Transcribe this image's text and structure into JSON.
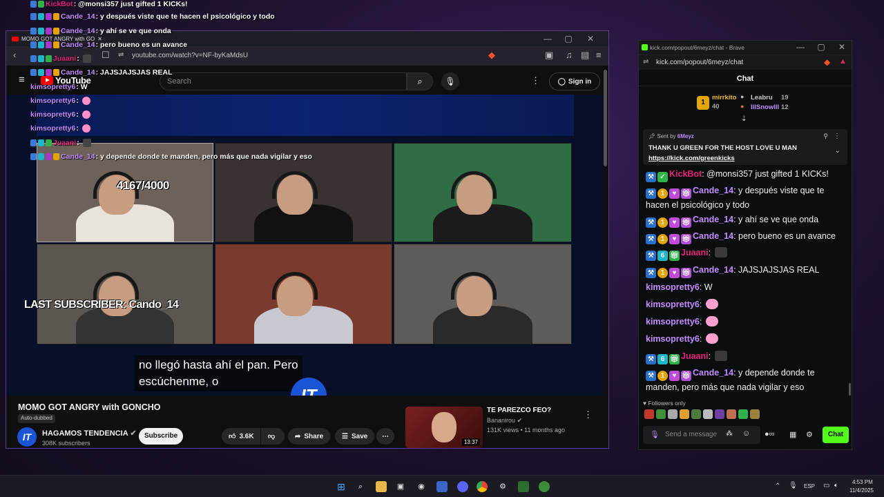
{
  "youtube": {
    "tab_title": "MOMO GOT ANGRY with GO",
    "url": "youtube.com/watch?v=NF-byKaMdsU",
    "search_placeholder": "Search",
    "logo": "YouTube",
    "signin_label": "Sign in",
    "overlay_sub_count": "4167/4000",
    "overlay_last_sub": "LAST SUBSCRIBER: Cando_14",
    "caption_line1": "no llegó hasta ahí el pan. Pero",
    "caption_line2": "escúchenme, o",
    "video_title": "MOMO GOT ANGRY with GONCHO",
    "auto_dubbed": "Auto-dubbed",
    "channel_name": "HAGAMOS TENDENCIA",
    "channel_subs": "308K subscribers",
    "subscribe_label": "Subscribe",
    "likes": "3.6K",
    "share_label": "Share",
    "save_label": "Save",
    "rec_title": "TE PAREZCO FEO?",
    "rec_channel": "Bananirou",
    "rec_meta": "131K views • 11 months ago",
    "rec_duration": "13:37"
  },
  "overlay_chat": [
    {
      "user": "KickBot",
      "text": " : @monsi357 just gifted 1 KICKs!",
      "color": "pink"
    },
    {
      "user": "Cande_14",
      "text": " : y después viste que te hacen el psicológico y todo",
      "color": "violet"
    },
    {
      "user": "Cande_14",
      "text": " : y ahí se ve que onda",
      "color": "violet"
    },
    {
      "user": "Cande_14",
      "text": " : pero bueno es un avance",
      "color": "violet"
    },
    {
      "user": "Juaani",
      "text": " :",
      "color": "pink"
    },
    {
      "user": "Cande_14",
      "text": " : JAJSJAJSJAS REAL",
      "color": "violet"
    },
    {
      "user": "kimsopretty6",
      "text": " : W",
      "color": "violet"
    },
    {
      "user": "kimsopretty6",
      "text": " :",
      "color": "violet"
    },
    {
      "user": "kimsopretty6",
      "text": " :",
      "color": "violet"
    },
    {
      "user": "kimsopretty6",
      "text": " :",
      "color": "violet"
    },
    {
      "user": "Juaani",
      "text": " :",
      "color": "pink"
    },
    {
      "user": "Cande_14",
      "text": " : y depende donde te manden, pero más que nada vigilar y eso",
      "color": "violet"
    }
  ],
  "kick": {
    "window_title": "kick.com/popout/6meyz/chat - Brave",
    "url": "kick.com/popout/6meyz/chat",
    "chat_header": "Chat",
    "leaderboard": [
      {
        "name": "mirrkito",
        "count": "40"
      },
      {
        "name": "Leabru",
        "count": "19"
      },
      {
        "name": "lllSnowlll",
        "count": "12"
      }
    ],
    "pinned_by_label": "Sent by",
    "pinned_by_user": "6Meyz",
    "pinned_message": "THANK U GREEN FOR THE HOST LOVE U MAN",
    "pinned_link": "https://kick.com/greenkicks",
    "messages": [
      {
        "user": "KickBot",
        "text": ": @monsi357 just gifted 1 KICKs!",
        "color": "#e6227c"
      },
      {
        "user": "Cande_14",
        "text": ": y después viste que te hacen el psicológico y todo",
        "color": "#c48bff"
      },
      {
        "user": "Cande_14",
        "text": ": y ahí se ve que onda",
        "color": "#c48bff"
      },
      {
        "user": "Cande_14",
        "text": ": pero bueno es un avance",
        "color": "#c48bff"
      },
      {
        "user": "Juaani",
        "text": ":",
        "color": "#e6227c"
      },
      {
        "user": "Cande_14",
        "text": ": JAJSJAJSJAS REAL",
        "color": "#c48bff"
      },
      {
        "user": "kimsopretty6",
        "text": ": W",
        "color": "#c48bff"
      },
      {
        "user": "kimsopretty6",
        "text": ":",
        "color": "#c48bff"
      },
      {
        "user": "kimsopretty6",
        "text": ":",
        "color": "#c48bff"
      },
      {
        "user": "kimsopretty6",
        "text": ":",
        "color": "#c48bff"
      },
      {
        "user": "Juaani",
        "text": ":",
        "color": "#e6227c"
      },
      {
        "user": "Cande_14",
        "text": ": y depende donde te manden, pero más que nada vigilar y eso",
        "color": "#c48bff"
      }
    ],
    "followers_only": "Followers only",
    "send_placeholder": "Send a message",
    "chat_button": "Chat"
  },
  "taskbar": {
    "lang": "ESP",
    "time": "4:53 PM",
    "date": "11/4/2025"
  }
}
